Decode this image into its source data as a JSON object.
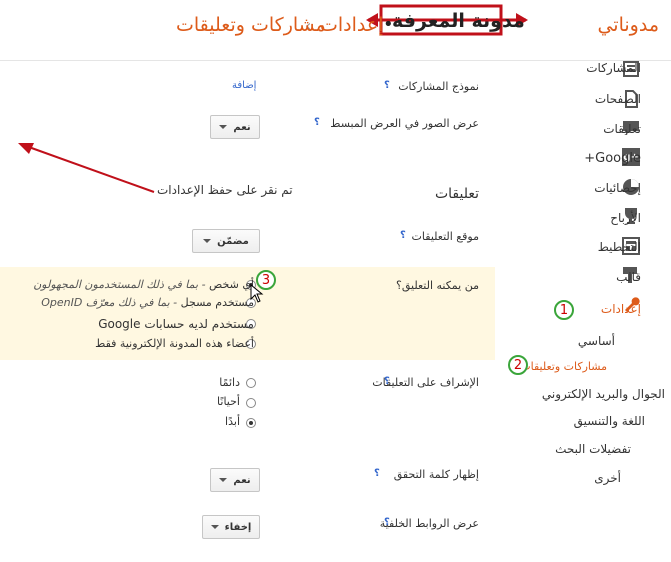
{
  "header": {
    "app_title": "مدوناتي",
    "blog_name": "مدونة المعرفة",
    "dot": "•",
    "section": "إعدادات",
    "separator": "›",
    "page": "مشاركات وتعليقات"
  },
  "sidebar": {
    "items": [
      {
        "label": "المشاركات",
        "icon": "posts-icon"
      },
      {
        "label": "الصفحات",
        "icon": "pages-icon"
      },
      {
        "label": "تعليقات",
        "icon": "comments-icon"
      },
      {
        "label": "Google+",
        "icon": "google-plus-icon"
      },
      {
        "label": "إحصائيات",
        "icon": "stats-icon"
      },
      {
        "label": "الأرباح",
        "icon": "earnings-icon"
      },
      {
        "label": "التخطيط",
        "icon": "layout-icon"
      },
      {
        "label": "قالب",
        "icon": "template-icon"
      },
      {
        "label": "إعدادات",
        "icon": "settings-wrench-icon"
      }
    ],
    "sub_items": [
      "أساسي",
      "مشاركات وتعليقات",
      "الجوال والبريد الإلكتروني",
      "اللغة والتنسيق",
      "تفضيلات البحث",
      "أخرى"
    ]
  },
  "main": {
    "post_template_label": "نموذج المشاركات",
    "post_template_link": "إضافة",
    "show_images_label": "عرض الصور في العرض المبسط",
    "show_images_value": "نعم",
    "annotation_text": "تم نقر على حفظ الإعدادات",
    "comments_heading": "تعليقات",
    "comment_location_label": "موقع التعليقات",
    "comment_location_value": "مضمّن",
    "who_can_comment_label": "من يمكنه التعليق؟",
    "who_can_comment_options": [
      {
        "main": "أي شخص",
        "note": " - بما في ذلك المستخدمون المجهولون"
      },
      {
        "main": "مستخدم مسجل",
        "note": " - بما في ذلك معرّف OpenID"
      },
      {
        "main": "مستخدم لديه حسابات Google",
        "note": ""
      },
      {
        "main": "أعضاء هذه المدونة الإلكترونية فقط",
        "note": ""
      }
    ],
    "moderation_label": "الإشراف على التعليقات",
    "moderation_options": [
      "دائمًا",
      "أحيانًا",
      "أبدًا"
    ],
    "captcha_label": "إظهار كلمة التحقق",
    "captcha_value": "نعم",
    "backlinks_label": "عرض الروابط الخلفية",
    "backlinks_value": "إخفاء",
    "help_mark": "؟"
  },
  "badges": [
    "1",
    "2",
    "3"
  ],
  "colors": {
    "accent": "#dd5b1a",
    "annotation_red": "#c0101a",
    "badge_green": "#3aa53a",
    "highlight_bg": "#fff8e1"
  }
}
